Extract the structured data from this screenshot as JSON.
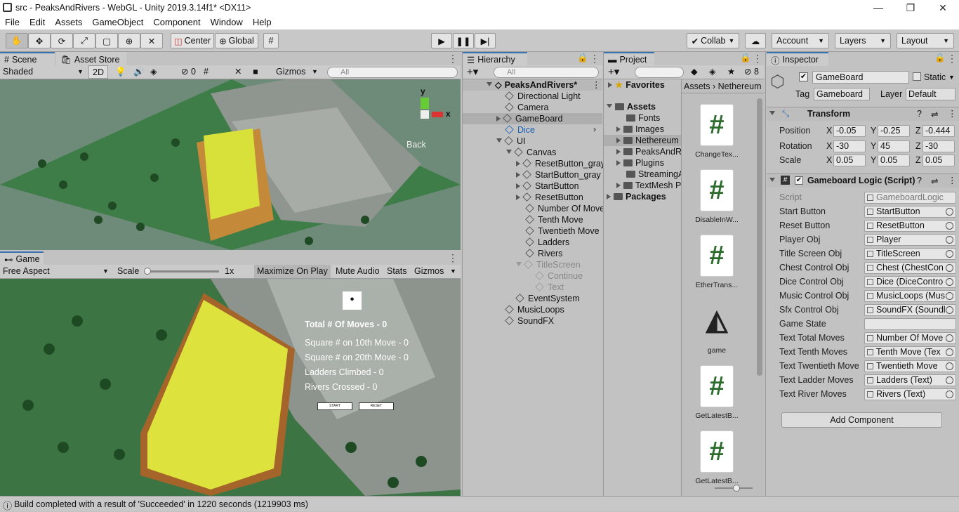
{
  "window": {
    "title": "src - PeaksAndRivers - WebGL - Unity 2019.3.14f1* <DX11>",
    "minimize": "—",
    "maximize": "❐",
    "close": "✕"
  },
  "menu": [
    "File",
    "Edit",
    "Assets",
    "GameObject",
    "Component",
    "Window",
    "Help"
  ],
  "toolbar": {
    "pivot": "Center",
    "space": "Global",
    "collab": "Collab",
    "account": "Account",
    "layers": "Layers",
    "layout": "Layout"
  },
  "scene_panel": {
    "tabs": [
      "Scene",
      "Asset Store"
    ],
    "shading": "Shaded",
    "mode_2d": "2D",
    "gizmos": "Gizmos",
    "search_placeholder": "All",
    "hidden_count": "0",
    "gizmo_axes": {
      "y": "y",
      "x": "x"
    },
    "view_label": "Back"
  },
  "game_panel": {
    "tab": "Game",
    "aspect": "Free Aspect",
    "scale_label": "Scale",
    "scale_value": "1x",
    "maximize_on_play": "Maximize On Play",
    "mute_audio": "Mute Audio",
    "stats": "Stats",
    "gizmos": "Gizmos",
    "overlay": {
      "total_moves": "Total # Of Moves - 0",
      "tenth_move": "Square # on 10th Move - 0",
      "twentieth_move": "Square # on 20th Move - 0",
      "ladders": "Ladders Climbed - 0",
      "rivers": "Rivers Crossed - 0",
      "start": "START",
      "reset": "RESET"
    }
  },
  "hierarchy": {
    "tab": "Hierarchy",
    "search_placeholder": "All",
    "root": "PeaksAndRivers*",
    "items": [
      "Directional Light",
      "Camera",
      "GameBoard",
      "Dice",
      "UI",
      "Canvas",
      "ResetButton_gray",
      "StartButton_gray",
      "StartButton",
      "ResetButton",
      "Number Of Moves",
      "Tenth Move",
      "Twentieth Move",
      "Ladders",
      "Rivers",
      "TitleScreen",
      "Continue",
      "Text",
      "EventSystem",
      "MusicLoops",
      "SoundFX"
    ]
  },
  "project": {
    "tab": "Project",
    "hidden_count": "8",
    "favorites": "Favorites",
    "assets": "Assets",
    "folders": [
      "Fonts",
      "Images",
      "Nethereum",
      "PeaksAndRivers",
      "Plugins",
      "StreamingAssets",
      "TextMesh Pro"
    ],
    "packages": "Packages",
    "breadcrumb": [
      "Assets",
      "Nethereum"
    ],
    "files": [
      "ChangeTex...",
      "DisableInW...",
      "EtherTrans...",
      "game",
      "GetLatestB...",
      "GetLatestB..."
    ]
  },
  "inspector": {
    "tab": "Inspector",
    "object_name": "GameBoard",
    "static_label": "Static",
    "tag_label": "Tag",
    "tag_value": "Gameboard",
    "layer_label": "Layer",
    "layer_value": "Default",
    "transform": {
      "title": "Transform",
      "position": {
        "label": "Position",
        "x": "-0.05",
        "y": "-0.25",
        "z": "-0.444"
      },
      "rotation": {
        "label": "Rotation",
        "x": "-30",
        "y": "45",
        "z": "-30"
      },
      "scale": {
        "label": "Scale",
        "x": "0.05",
        "y": "0.05",
        "z": "0.05"
      }
    },
    "script_component": {
      "title": "Gameboard Logic (Script)",
      "fields": [
        {
          "label": "Script",
          "value": "GameboardLogic"
        },
        {
          "label": "Start Button",
          "value": "StartButton"
        },
        {
          "label": "Reset Button",
          "value": "ResetButton"
        },
        {
          "label": "Player Obj",
          "value": "Player"
        },
        {
          "label": "Title Screen Obj",
          "value": "TitleScreen"
        },
        {
          "label": "Chest Control Obj",
          "value": "Chest (ChestCon"
        },
        {
          "label": "Dice Control Obj",
          "value": "Dice (DiceContro"
        },
        {
          "label": "Music Control Obj",
          "value": "MusicLoops (Mus"
        },
        {
          "label": "Sfx Control Obj",
          "value": "SoundFX (Soundl"
        },
        {
          "label": "Game State",
          "value": ""
        },
        {
          "label": "Text Total Moves",
          "value": "Number Of Move"
        },
        {
          "label": "Text Tenth Moves",
          "value": "Tenth Move (Tex"
        },
        {
          "label": "Text Twentieth Move",
          "value": "Twentieth Move"
        },
        {
          "label": "Text Ladder Moves",
          "value": "Ladders (Text)"
        },
        {
          "label": "Text River Moves",
          "value": "Rivers (Text)"
        }
      ]
    },
    "add_component": "Add Component"
  },
  "status": "Build completed with a result of 'Succeeded' in 1220 seconds (1219903 ms)"
}
